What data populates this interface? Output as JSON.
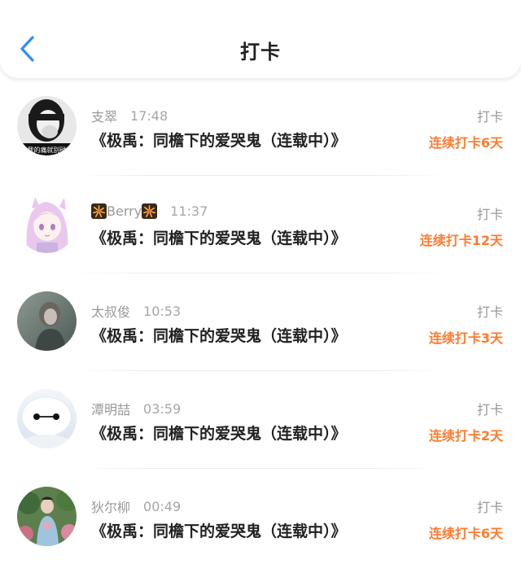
{
  "header": {
    "title": "打卡"
  },
  "accent_color": "#ff7a2e",
  "back_icon_color": "#2f8ef5",
  "rows": [
    {
      "name": "支翠",
      "time": "17:48",
      "book": "《极禹：同檐下的爱哭鬼（连载中）》",
      "action": "打卡",
      "streak": "连续打卡6天",
      "avatar_text": "我的痛就别碰"
    },
    {
      "name": "Berry",
      "time": "11:37",
      "book": "《极禹：同檐下的爱哭鬼（连载中）》",
      "action": "打卡",
      "streak": "连续打卡12天"
    },
    {
      "name": "太叔俊",
      "time": "10:53",
      "book": "《极禹：同檐下的爱哭鬼（连载中）》",
      "action": "打卡",
      "streak": "连续打卡3天"
    },
    {
      "name": "潭明喆",
      "time": "03:59",
      "book": "《极禹：同檐下的爱哭鬼（连载中）》",
      "action": "打卡",
      "streak": "连续打卡2天"
    },
    {
      "name": "狄尔柳",
      "time": "00:49",
      "book": "《极禹：同檐下的爱哭鬼（连载中）》",
      "action": "打卡",
      "streak": "连续打卡6天"
    }
  ]
}
